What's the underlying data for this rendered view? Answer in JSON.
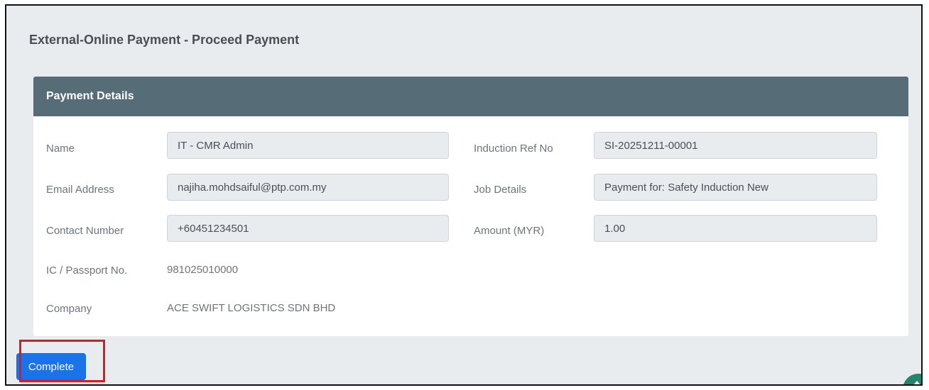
{
  "page": {
    "title": "External-Online Payment - Proceed Payment"
  },
  "card": {
    "header": "Payment Details"
  },
  "fields": {
    "name": {
      "label": "Name",
      "value": "IT - CMR Admin"
    },
    "email": {
      "label": "Email Address",
      "value": "najiha.mohdsaiful@ptp.com.my"
    },
    "contact": {
      "label": "Contact Number",
      "value": "+60451234501"
    },
    "ic": {
      "label": "IC / Passport No.",
      "value": "981025010000"
    },
    "company": {
      "label": "Company",
      "value": "ACE SWIFT LOGISTICS SDN BHD"
    },
    "induction_ref": {
      "label": "Induction Ref No",
      "value": "SI-20251211-00001"
    },
    "job_details": {
      "label": "Job Details",
      "value": "Payment for: Safety Induction New"
    },
    "amount": {
      "label": "Amount (MYR)",
      "value": "1.00"
    }
  },
  "actions": {
    "complete_label": "Complete"
  },
  "colors": {
    "header_bg": "#566d78",
    "primary": "#1a73e8",
    "highlight": "#e0191f",
    "fab": "#23866a"
  },
  "icons": {
    "scroll_top": "chevron-up-icon"
  }
}
